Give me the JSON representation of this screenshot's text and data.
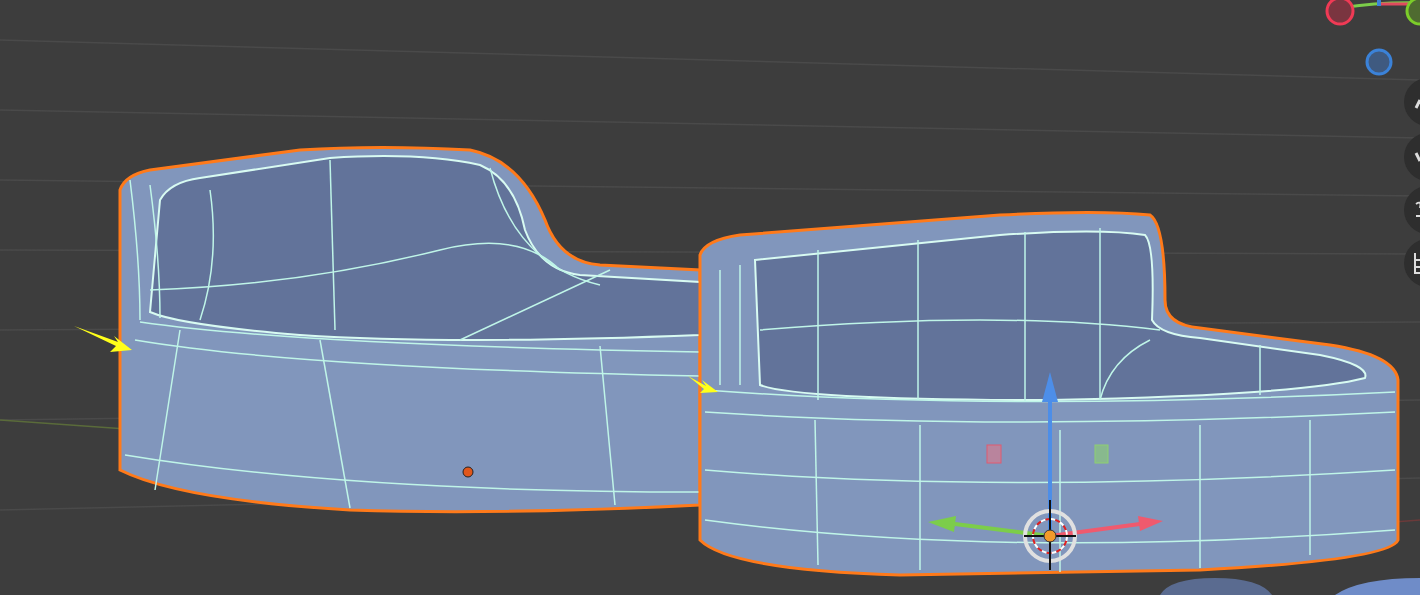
{
  "viewport": {
    "objects": [
      {
        "selected": true
      },
      {
        "selected": true
      }
    ]
  }
}
